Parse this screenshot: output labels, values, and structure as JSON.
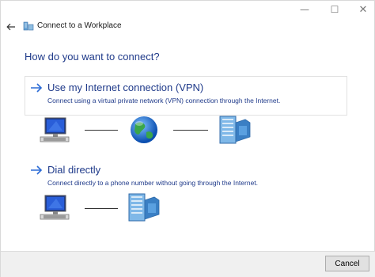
{
  "window": {
    "title": "Connect to a Workplace",
    "caption_buttons": {
      "minimize": "—",
      "maximize": "☐",
      "close": "✕"
    }
  },
  "heading": "How do you want to connect?",
  "options": [
    {
      "title": "Use my Internet connection (VPN)",
      "description": "Connect using a virtual private network (VPN) connection through the Internet.",
      "diagram": [
        "computer-icon",
        "internet-globe-icon",
        "workplace-server-icon"
      ]
    },
    {
      "title": "Dial directly",
      "description": "Connect directly to a phone number without going through the Internet.",
      "diagram": [
        "computer-icon",
        "workplace-server-icon"
      ]
    }
  ],
  "footer": {
    "cancel_label": "Cancel"
  },
  "colors": {
    "link_blue": "#1f3a8a",
    "accent_blue": "#2b6bd6"
  }
}
